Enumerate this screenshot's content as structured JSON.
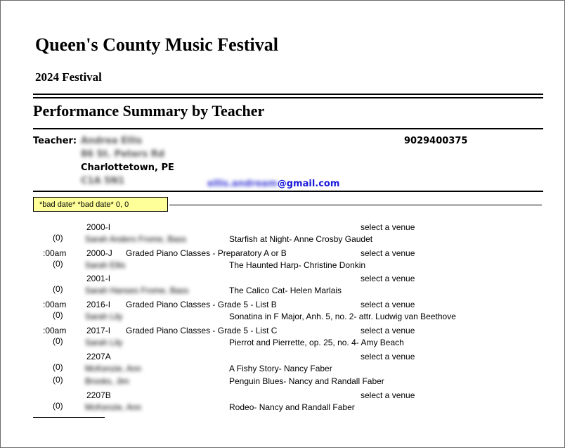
{
  "header": {
    "title": "Queen's County Music Festival",
    "festival": "2024 Festival",
    "report_title": "Performance Summary by Teacher"
  },
  "teacher": {
    "label": "Teacher:",
    "name_redacted": "Andrea Ellis",
    "address_line1_redacted": "86 St. Peters Rd",
    "city": "Charlottetown, PE",
    "postal_redacted": "C1A 5N1",
    "phone": "9029400375",
    "email_redacted": "ellis.andream",
    "email_domain": "@gmail.com"
  },
  "date_box": {
    "text": "*bad date*  *bad date* 0, 0"
  },
  "entries": [
    {
      "time": "",
      "class_code": "2000-I",
      "class_name": "",
      "venue": "select a venue",
      "count": "(0)",
      "performer_redacted": "Sarah Anders Frome, Bass",
      "piece": "Starfish at Night- Anne Crosby Gaudet"
    },
    {
      "time": ":00am",
      "class_code": "2000-J",
      "class_name": "Graded Piano Classes - Preparatory A or B",
      "venue": "select a venue",
      "count": "(0)",
      "performer_redacted": "Sarah Ellis",
      "piece": "The Haunted Harp- Christine Donkin"
    },
    {
      "time": "",
      "class_code": "2001-I",
      "class_name": "",
      "venue": "select a venue",
      "count": "(0)",
      "performer_redacted": "Sarah Hanses Frome, Bass",
      "piece": "The Calico Cat- Helen Marlais"
    },
    {
      "time": ":00am",
      "class_code": "2016-I",
      "class_name": "Graded Piano Classes - Grade 5 - List B",
      "venue": "select a venue",
      "count": "(0)",
      "performer_redacted": "Sarah Lily",
      "piece": "Sonatina in F Major, Anh. 5, no. 2- attr. Ludwig van Beethove"
    },
    {
      "time": ":00am",
      "class_code": "2017-I",
      "class_name": "Graded Piano Classes - Grade 5 - List C",
      "venue": "select a venue",
      "count": "(0)",
      "performer_redacted": "Sarah Lily",
      "piece": "Pierrot and Pierrette, op. 25, no. 4- Amy Beach"
    },
    {
      "time": "",
      "class_code": "2207A",
      "class_name": "",
      "venue": "select a venue",
      "count": "(0)",
      "performer_redacted": "McKenzie, Ann",
      "piece": "A Fishy Story- Nancy Faber"
    },
    {
      "time": "",
      "class_code": "",
      "class_name": "",
      "venue": "",
      "count": "(0)",
      "performer_redacted": "Brooks, Jim",
      "piece": "Penguin Blues- Nancy and Randall Faber"
    },
    {
      "time": "",
      "class_code": "2207B",
      "class_name": "",
      "venue": "select a venue",
      "count": "(0)",
      "performer_redacted": "McKenzie, Ann",
      "piece": "Rodeo- Nancy and Randall Faber"
    }
  ]
}
